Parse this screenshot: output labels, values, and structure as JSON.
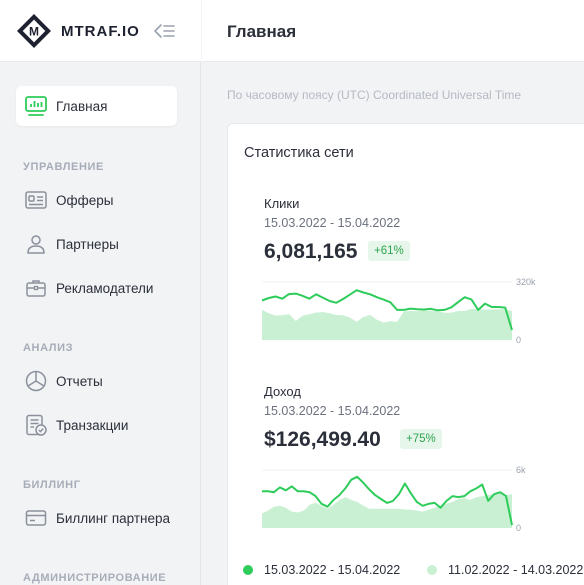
{
  "brand": {
    "name": "MTRAF.IO",
    "logo_letter": "M"
  },
  "sidebar": {
    "active": {
      "label": "Главная",
      "icon": "dashboard-icon"
    },
    "sections": [
      {
        "title": "УПРАВЛЕНИЕ",
        "items": [
          {
            "label": "Офферы",
            "icon": "id-card-icon"
          },
          {
            "label": "Партнеры",
            "icon": "user-icon"
          },
          {
            "label": "Рекламодатели",
            "icon": "briefcase-icon"
          }
        ]
      },
      {
        "title": "АНАЛИЗ",
        "items": [
          {
            "label": "Отчеты",
            "icon": "pie-chart-icon"
          },
          {
            "label": "Транзакции",
            "icon": "receipt-check-icon"
          }
        ]
      },
      {
        "title": "БИЛЛИНГ",
        "items": [
          {
            "label": "Биллинг партнера",
            "icon": "wallet-icon"
          }
        ]
      },
      {
        "title": "АДМИНИСТРИРОВАНИЕ",
        "items": []
      }
    ]
  },
  "header": {
    "title": "Главная"
  },
  "timezone_note": "По часовому поясу (UTC) Coordinated Universal Time",
  "stats_card": {
    "title": "Статистика сети",
    "metrics": [
      {
        "name": "Клики",
        "range": "15.03.2022 - 15.04.2022",
        "value": "6,081,165",
        "change": "+61%"
      },
      {
        "name": "Доход",
        "range": "15.03.2022 - 15.04.2022",
        "value": "$126,499.40",
        "change": "+75%"
      }
    ],
    "legend": [
      {
        "label": "15.03.2022 - 15.04.2022",
        "color": "#2ecc5a"
      },
      {
        "label": "11.02.2022 - 14.03.2022",
        "color": "#c9f0d2"
      }
    ]
  },
  "colors": {
    "accent": "#2ecc5a",
    "previous": "#c9f0d2"
  },
  "chart_data": [
    {
      "type": "area",
      "title": "Клики",
      "ylim": [
        0,
        320000
      ],
      "yticks": [
        "320k",
        "0"
      ],
      "grid": false,
      "series": [
        {
          "name": "15.03.2022 - 15.04.2022",
          "values": [
            218000,
            232000,
            240000,
            228000,
            253000,
            256000,
            244000,
            228000,
            252000,
            234000,
            215000,
            205000,
            226000,
            250000,
            275000,
            262000,
            252000,
            236000,
            223000,
            208000,
            166000,
            166000,
            173000,
            170000,
            168000,
            172000,
            164000,
            166000,
            180000,
            208000,
            236000,
            223000,
            166000,
            201000,
            182000,
            182000,
            179000,
            55000
          ]
        },
        {
          "name": "11.02.2022 - 14.03.2022",
          "values": [
            166000,
            148000,
            135000,
            137000,
            143000,
            105000,
            134000,
            142000,
            152000,
            154000,
            148000,
            138000,
            137000,
            124000,
            100000,
            127000,
            138000,
            112000,
            96000,
            104000,
            100000,
            158000,
            160000,
            159000,
            163000,
            162000,
            160000,
            150000,
            150000,
            160000,
            160000,
            172000,
            170000,
            168000,
            168000,
            170000,
            170000,
            160000
          ]
        }
      ]
    },
    {
      "type": "area",
      "title": "Доход",
      "ylim": [
        0,
        6000
      ],
      "yticks": [
        "6k",
        "0"
      ],
      "grid": false,
      "series": [
        {
          "name": "15.03.2022 - 15.04.2022",
          "values": [
            3800,
            3800,
            3700,
            4200,
            3900,
            4300,
            3800,
            3800,
            3700,
            3300,
            2500,
            2200,
            2900,
            3400,
            4100,
            5000,
            5300,
            4700,
            4000,
            3400,
            3000,
            2600,
            2800,
            3500,
            4600,
            3600,
            2700,
            2300,
            2500,
            2600,
            2100,
            2800,
            3300,
            3200,
            3300,
            3800,
            4100,
            4500,
            2800,
            3500,
            3700,
            3300,
            300
          ]
        },
        {
          "name": "11.02.2022 - 14.03.2022",
          "values": [
            1500,
            1800,
            2200,
            2300,
            2100,
            1700,
            1600,
            1800,
            2400,
            2600,
            2300,
            2000,
            2400,
            2900,
            3200,
            2900,
            2700,
            2300,
            2000,
            2000,
            2000,
            2000,
            2000,
            2000,
            1900,
            1900,
            1800,
            1700,
            1900,
            2100,
            2300,
            2500,
            2700,
            3000,
            3100,
            2900,
            3200,
            3300,
            3400,
            3500,
            3600,
            3400,
            3500
          ]
        }
      ]
    }
  ]
}
